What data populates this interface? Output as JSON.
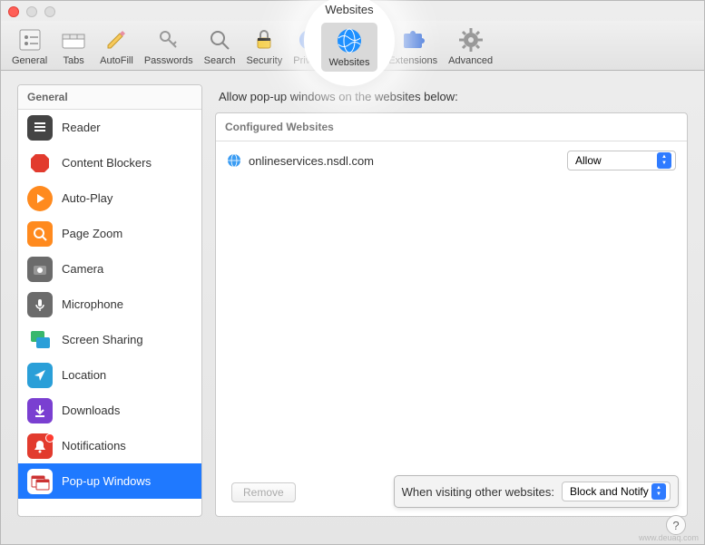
{
  "window_title": "Websites",
  "toolbar": {
    "general": "General",
    "tabs": "Tabs",
    "autofill": "AutoFill",
    "passwords": "Passwords",
    "search": "Search",
    "security": "Security",
    "privacy": "Privacy",
    "websites": "Websites",
    "extensions": "Extensions",
    "advanced": "Advanced"
  },
  "highlight": {
    "title": "Websites",
    "label": "Websites"
  },
  "sidebar": {
    "header": "General",
    "items": [
      {
        "label": "Reader"
      },
      {
        "label": "Content Blockers"
      },
      {
        "label": "Auto-Play"
      },
      {
        "label": "Page Zoom"
      },
      {
        "label": "Camera"
      },
      {
        "label": "Microphone"
      },
      {
        "label": "Screen Sharing"
      },
      {
        "label": "Location"
      },
      {
        "label": "Downloads"
      },
      {
        "label": "Notifications"
      },
      {
        "label": "Pop-up Windows"
      }
    ]
  },
  "main": {
    "heading": "Allow pop-up windows on the websites below:",
    "panel_header": "Configured Websites",
    "rows": [
      {
        "site": "onlineservices.nsdl.com",
        "value": "Allow"
      }
    ],
    "remove_label": "Remove",
    "footer_label": "When visiting other websites:",
    "footer_value": "Block and Notify"
  },
  "help": "?",
  "watermark": "www.deuaq.com"
}
